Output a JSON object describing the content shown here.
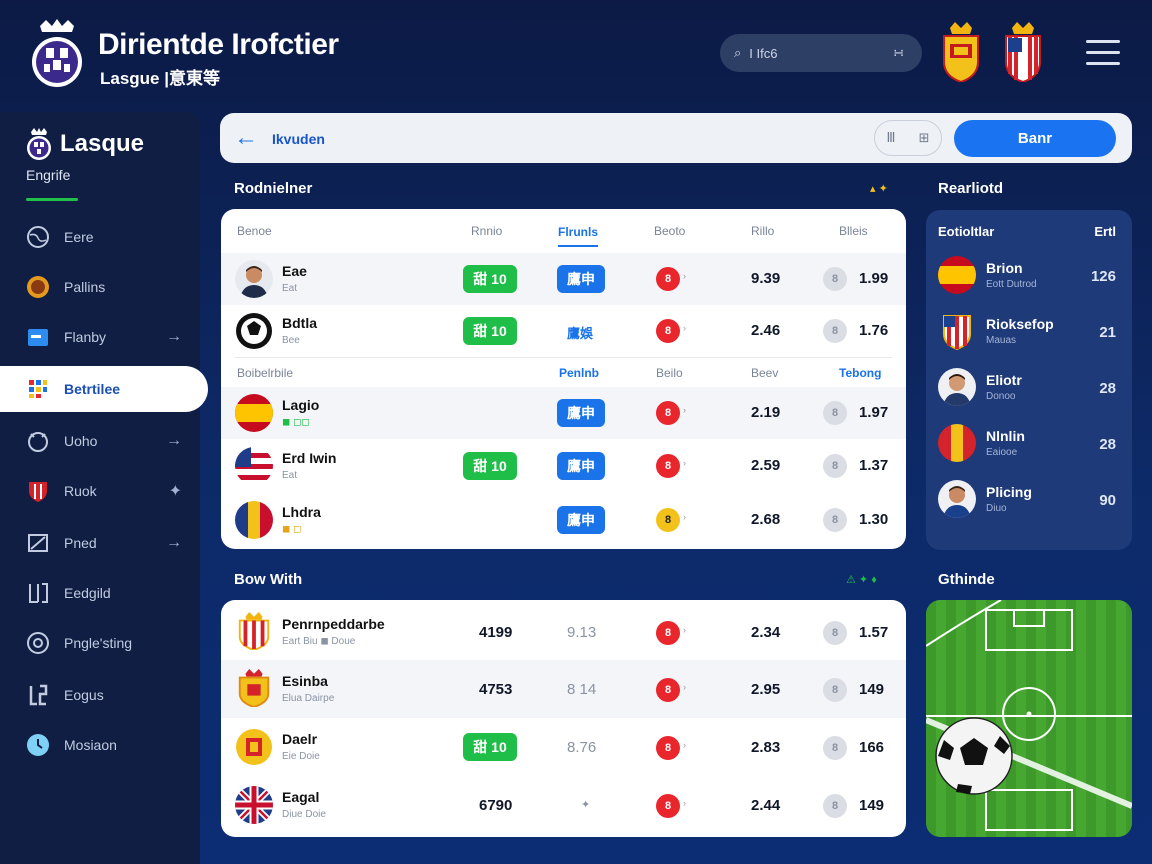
{
  "header": {
    "title": "Dirientde Irofctier",
    "subtitle": "Lasgue |意東等",
    "search_placeholder": "I Ifc6",
    "search_icon_glyph": "⌕",
    "search_action": "∺"
  },
  "sidebar": {
    "title": "Lasque",
    "subtitle": "Engrife",
    "items": [
      {
        "label": "Eere",
        "icon": "globe-icon",
        "arrow": false
      },
      {
        "label": "Pallins",
        "icon": "medal-icon",
        "arrow": false
      },
      {
        "label": "Flanby",
        "icon": "folder-icon",
        "arrow": true
      },
      {
        "label": "Betrtilee",
        "icon": "grid-icon",
        "arrow": false,
        "active": true
      },
      {
        "label": "Uoho",
        "icon": "ball-icon",
        "arrow": true
      },
      {
        "label": "Ruok",
        "icon": "shield-icon",
        "arrow": true
      },
      {
        "label": "Pned",
        "icon": "flag-icon",
        "arrow": true
      },
      {
        "label": "Eedgild",
        "icon": "bracket-icon",
        "arrow": false
      },
      {
        "label": "Pngle'sting",
        "icon": "target-icon",
        "arrow": false
      },
      {
        "label": "Eogus",
        "icon": "letter-icon",
        "arrow": false
      },
      {
        "label": "Mosiaon",
        "icon": "clock-icon",
        "arrow": false
      }
    ]
  },
  "topbar": {
    "back_label": "Ikvuden",
    "toggle_left": "Ⅲ",
    "toggle_right": "⊞",
    "button_label": "Banr"
  },
  "section1": {
    "title": "Rodnielner",
    "icons": "▴ ✦",
    "headers": [
      "Benoe",
      "Rnnio",
      "Flrunls",
      "Beoto",
      "Rillo",
      "Blleis"
    ],
    "rows": [
      {
        "name": "Eae",
        "sub": "Eat",
        "badge": "甜 10",
        "pill": "鷹申",
        "odd1": "9.39",
        "odd2": "1.99",
        "avatar": "player-avatar",
        "dot": "red"
      },
      {
        "name": "Bdtla",
        "sub": "Bee",
        "badge": "甜 10",
        "link": "鷹娛",
        "odd1": "2.46",
        "odd2": "1.76",
        "avatar": "ball-logo",
        "dot": "red"
      }
    ],
    "subheader": [
      "Boibelrbile",
      "Penlnb",
      "Beilo",
      "Beev",
      "Tebong"
    ],
    "rows2": [
      {
        "name": "Lagio",
        "sub": "◼ ◻◻",
        "pill": "鷹申",
        "odd1": "2.19",
        "odd2": "1.97",
        "avatar": "spain-flag",
        "dot": "red"
      },
      {
        "name": "Erd Iwin",
        "sub": "Eat",
        "badge": "甜 10",
        "pill": "鷹申",
        "odd1": "2.59",
        "odd2": "1.37",
        "avatar": "stripes-flag",
        "dot": "red"
      },
      {
        "name": "Lhdra",
        "sub": "◼ ◻",
        "pill": "鷹申",
        "odd1": "2.68",
        "odd2": "1.30",
        "avatar": "tricolor-flag",
        "dot": "yellow"
      }
    ]
  },
  "right_panel": {
    "title": "Rearliotd",
    "header_left": "Eotioltlar",
    "header_right": "Ertl",
    "rows": [
      {
        "name": "Brion",
        "sub": "Eott Dutrod",
        "value": "126",
        "icon": "spain-flag"
      },
      {
        "name": "Rioksefop",
        "sub": "Mauas",
        "value": "21",
        "icon": "crest"
      },
      {
        "name": "Eliotr",
        "sub": "Donoo",
        "value": "28",
        "icon": "player-avatar"
      },
      {
        "name": "Nlnlin",
        "sub": "Eaiooe",
        "value": "28",
        "icon": "belgium-flag"
      },
      {
        "name": "Plicing",
        "sub": "Diuo",
        "value": "90",
        "icon": "player-avatar"
      }
    ]
  },
  "section2": {
    "title": "Bow With",
    "icons": "⚠ ✦ ♦",
    "rows": [
      {
        "name": "Penrnpeddarbe",
        "sub": "Eart Biu  ◼ Doue",
        "v1": "4199",
        "v2": "9.13",
        "odd1": "2.34",
        "odd2": "1.57",
        "icon": "crest-striped",
        "badge": ""
      },
      {
        "name": "Esinba",
        "sub": "Elua Dairpe",
        "v1": "4753",
        "v2": "8 14",
        "odd1": "2.95",
        "odd2": "149",
        "icon": "crest-gold",
        "badge": ""
      },
      {
        "name": "Daelr",
        "sub": "Eie Doie",
        "v1": "",
        "v2": "8.76",
        "odd1": "2.83",
        "odd2": "166",
        "icon": "crest-yellow",
        "badge": "甜 10"
      },
      {
        "name": "Eagal",
        "sub": "Diue Doie",
        "v1": "6790",
        "v2": "✦",
        "odd1": "2.44",
        "odd2": "149",
        "icon": "uk-flag",
        "badge": ""
      }
    ]
  },
  "field_panel": {
    "title": "Gthinde"
  },
  "colors": {
    "accent_green": "#1fbe49",
    "accent_blue": "#1a73e8",
    "odds_red": "#e8262c"
  }
}
